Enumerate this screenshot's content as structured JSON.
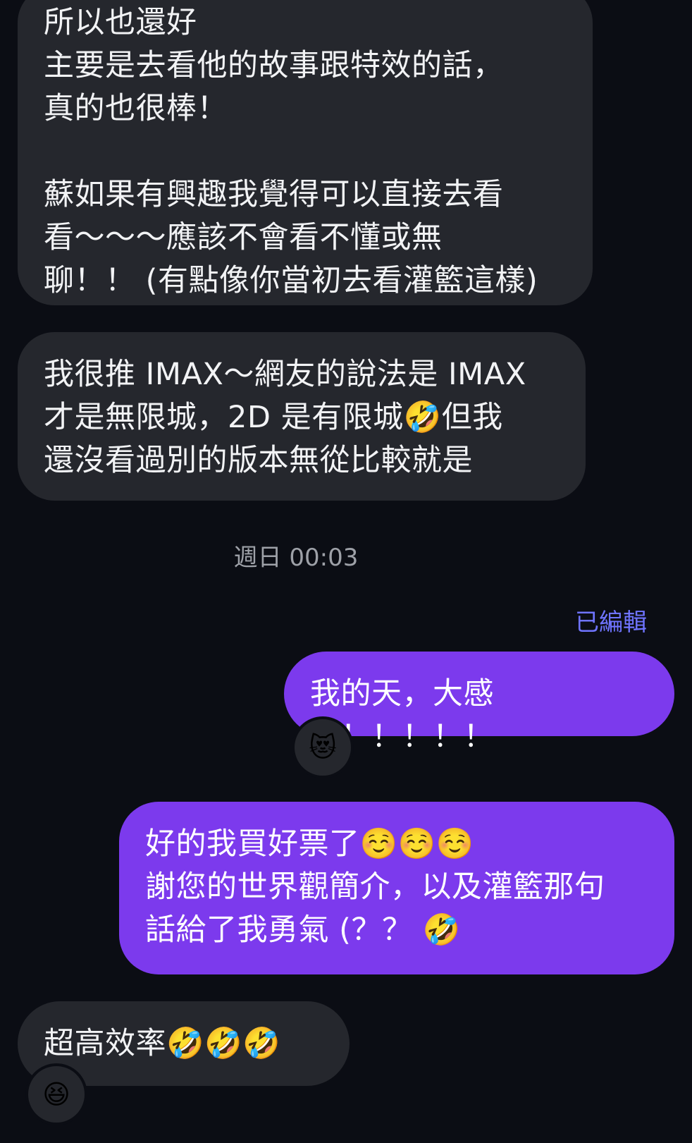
{
  "messages": [
    {
      "id": "m1",
      "side": "incoming",
      "text": "所以也還好\n主要是去看他的故事跟特效的話，\n真的也很棒！\n\n蘇如果有興趣我覺得可以直接去看\n看～～～應該不會看不懂或無\n聊！！ (有點像你當初去看灌籃這樣)"
    },
    {
      "id": "m2",
      "side": "incoming",
      "text": "我很推 IMAX～網友的說法是 IMAX\n才是無限城，2D 是有限城🤣但我\n還沒看過別的版本無從比較就是"
    },
    {
      "id": "m3",
      "side": "outgoing",
      "text": "我的天，大感謝！！！！！",
      "reaction": "😻"
    },
    {
      "id": "m4",
      "side": "outgoing",
      "text": "好的我買好票了☺️☺️☺️\n謝您的世界觀簡介，以及灌籃那句\n話給了我勇氣 (？？ 🤣"
    },
    {
      "id": "m5",
      "side": "incoming",
      "text": "超高效率🤣🤣🤣",
      "reaction": "😆"
    }
  ],
  "timestamp": "週日 00:03",
  "edited_label": "已編輯",
  "colors": {
    "background": "#0b0d14",
    "incoming": "#25272d",
    "outgoing": "#7c3aed",
    "edited": "#6f74ff"
  }
}
